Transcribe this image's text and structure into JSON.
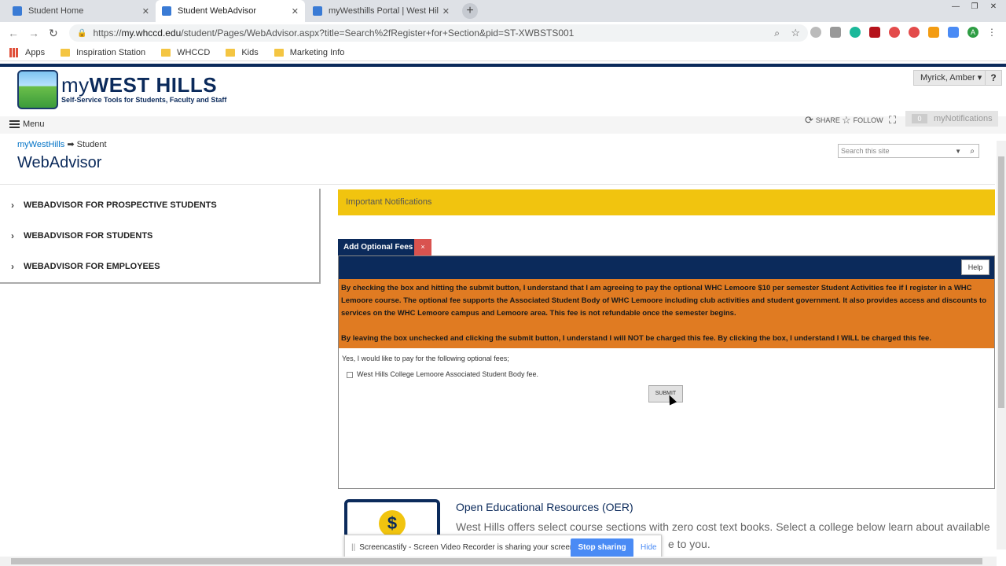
{
  "browser": {
    "tabs": [
      {
        "label": "Student Home",
        "active": false
      },
      {
        "label": "Student WebAdvisor",
        "active": true
      },
      {
        "label": "myWesthills Portal | West Hills Co",
        "active": false
      }
    ],
    "url_scheme": "https://",
    "url_host": "my.whccd.edu",
    "url_path": "/student/Pages/WebAdvisor.aspx?title=Search%2fRegister+for+Section&pid=ST-XWBSTS001",
    "bookmarks": [
      "Apps",
      "Inspiration Station",
      "WHCCD",
      "Kids",
      "Marketing Info"
    ],
    "profile_initial": "A"
  },
  "site": {
    "logo_my": "my",
    "logo_name": "WEST HILLS",
    "logo_tagline": "Self-Service Tools for Students, Faculty and Staff",
    "user": "Myrick, Amber",
    "help": "?",
    "menu": "Menu",
    "share": "SHARE",
    "follow": "FOLLOW",
    "notifications_count": "0",
    "notifications_label": "myNotifications",
    "breadcrumb_root": "myWestHills",
    "breadcrumb_sep": "➡",
    "breadcrumb_current": "Student",
    "page_title": "WebAdvisor",
    "search_placeholder": "Search this site"
  },
  "leftnav": [
    "WEBADVISOR FOR PROSPECTIVE STUDENTS",
    "WEBADVISOR FOR STUDENTS",
    "WEBADVISOR FOR EMPLOYEES"
  ],
  "notifications_bar": "Important Notifications",
  "fees": {
    "tab_label": "Add Optional Fees",
    "tab_close": "×",
    "help_label": "Help",
    "notice_p1": "By checking the box and hitting the submit button, I understand that I am agreeing to pay the optional WHC Lemoore $10 per semester Student Activities fee if I register in a WHC Lemoore course. The optional fee supports the Associated Student Body of WHC Lemoore including club activities and student government. It also provides access and discounts to services on the WHC Lemoore campus and Lemoore area. This fee is not refundable once the semester begins.",
    "notice_p2": "By leaving the box unchecked and clicking the submit button, I understand I will NOT be charged this fee. By clicking the box, I understand I WILL be charged this fee.",
    "prompt": "Yes, I would like to pay for the following optional fees;",
    "checkbox_label": "West Hills College Lemoore Associated Student Body fee.",
    "checked": false,
    "submit_label": "SUBMIT"
  },
  "oer": {
    "title": "Open Educational Resources (OER)",
    "text_line1": "West Hills offers select course sections with zero cost text books. Select a college below learn about available",
    "text_line2": "e to you."
  },
  "screencastify": {
    "message": "Screencastify - Screen Video Recorder is sharing your screen.",
    "stop_label": "Stop sharing",
    "hide_label": "Hide"
  },
  "colors": {
    "navy": "#0b2a5b",
    "notice_yellow": "#f1c40f",
    "fee_orange": "#e07b22",
    "close_red": "#d9534f"
  }
}
